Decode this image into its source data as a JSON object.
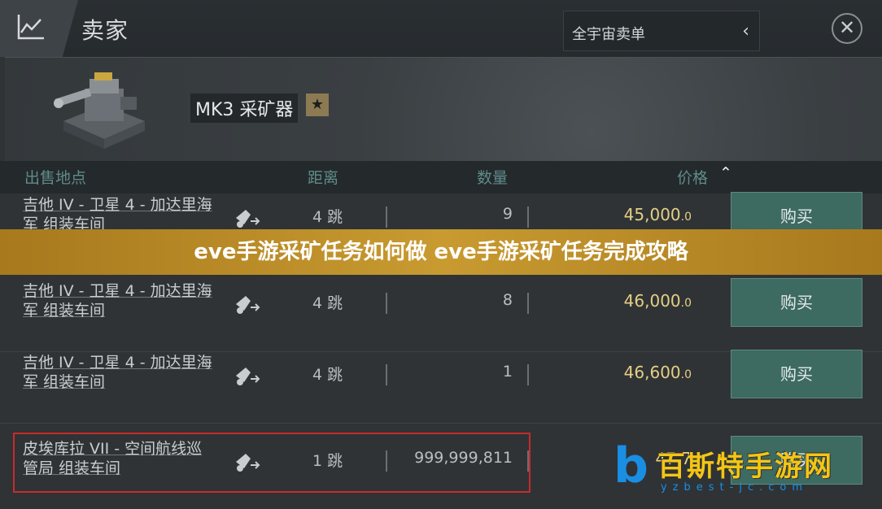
{
  "header": {
    "title": "卖家",
    "market_select": "全宇宙卖单"
  },
  "item": {
    "name": "MK3 采矿器"
  },
  "columns": {
    "location": "出售地点",
    "distance": "距离",
    "quantity": "数量",
    "price": "价格"
  },
  "rows": [
    {
      "loc_line1": "吉他 IV - 卫星 4 - 加达里海",
      "loc_line2": "军 组装车间",
      "jumps": "4 跳",
      "qty": "9",
      "price": "45,000",
      "price_dec": ".0",
      "buy": "购买"
    },
    {
      "loc_line1": "吉他 IV - 卫星 4 - 加达里海",
      "loc_line2": "军 组装车间",
      "jumps": "4 跳",
      "qty": "8",
      "price": "46,000",
      "price_dec": ".0",
      "buy": "购买"
    },
    {
      "loc_line1": "吉他 IV - 卫星 4 - 加达里海",
      "loc_line2": "军 组装车间",
      "jumps": "4 跳",
      "qty": "1",
      "price": "46,600",
      "price_dec": ".0",
      "buy": "购买"
    },
    {
      "loc_line1": "皮埃库拉 VII - 空间航线巡",
      "loc_line2": "管局 组装车间",
      "jumps": "1 跳",
      "qty": "999,999,811",
      "price": "47,7",
      "price_dec": "",
      "buy": "购买"
    }
  ],
  "banner": "eve手游采矿任务如何做 eve手游采矿任务完成攻略",
  "watermark": {
    "text": "百斯特手游网",
    "url": "yzbest-jc.com"
  },
  "colors": {
    "accent_teal": "#5f8c8a",
    "price_gold": "#e5cf84",
    "buy_button": "#3d6a61",
    "banner": "#c89a30",
    "highlight_red": "#c92a2a"
  }
}
